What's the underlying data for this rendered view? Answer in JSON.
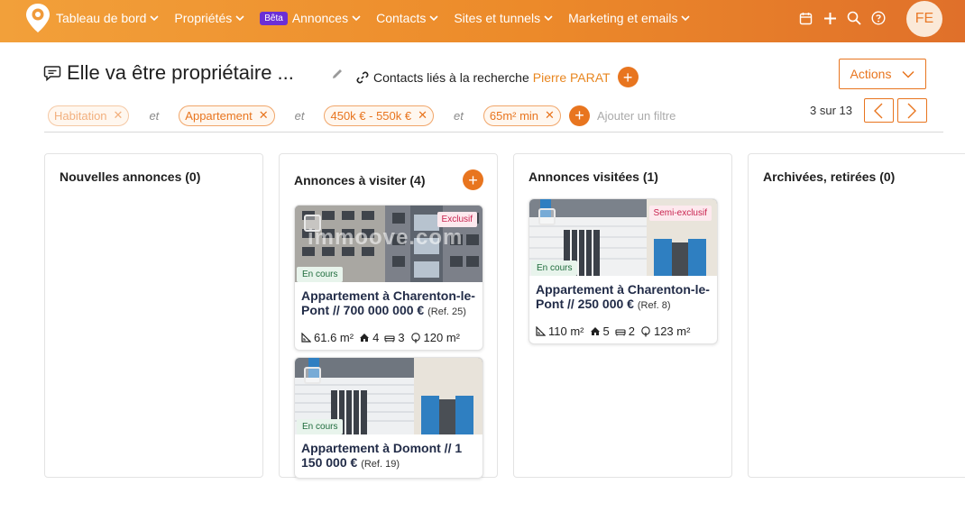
{
  "colors": {
    "accent": "#e8751f",
    "nav_start": "#f2a03a",
    "nav_end": "#e0702a",
    "beta": "#6b2fd6",
    "badge_text": "#c8234f",
    "status_text": "#1e6c3c"
  },
  "nav": {
    "items": [
      {
        "label": "Tableau de bord"
      },
      {
        "label": "Propriétés"
      },
      {
        "label": "Annonces",
        "badge": "Bêta"
      },
      {
        "label": "Contacts"
      },
      {
        "label": "Sites et tunnels"
      },
      {
        "label": "Marketing et emails"
      }
    ],
    "icons": [
      "calendar-icon",
      "plus-icon",
      "search-icon",
      "help-icon"
    ],
    "avatar": "FE"
  },
  "search": {
    "title": "Elle va être propriétaire ...",
    "linked_label": "Contacts liés à la recherche",
    "linked_contact": "Pierre PARAT",
    "actions_label": "Actions"
  },
  "filters": {
    "chips": [
      "Habitation",
      "Appartement",
      "450k € - 550k €",
      "65m² min"
    ],
    "connector": "et",
    "add_label": "Ajouter un filtre",
    "pager": "3 sur 13"
  },
  "columns": [
    {
      "title": "Nouvelles annonces (0)"
    },
    {
      "title": "Annonces à visiter (4)"
    },
    {
      "title": "Annonces visitées (1)"
    },
    {
      "title": "Archivées, retirées (0)"
    }
  ],
  "cards": [
    {
      "badge": "Exclusif",
      "status": "En cours",
      "watermark": "immoove.com",
      "title": "Appartement à Charenton-le-Pont // 700 000 000 €",
      "ref": "(Ref. 25)",
      "area": "61.6 m²",
      "rooms": "4",
      "beds": "3",
      "land": "120 m²"
    },
    {
      "status": "En cours",
      "title": "Appartement à Domont // 1 150 000 €",
      "ref": "(Ref. 19)"
    },
    {
      "badge": "Semi-exclusif",
      "status": "En cours",
      "title": "Appartement à Charenton-le-Pont // 250 000 €",
      "ref": "(Ref. 8)",
      "area": "110 m²",
      "rooms": "5",
      "beds": "2",
      "land": "123 m²"
    }
  ]
}
